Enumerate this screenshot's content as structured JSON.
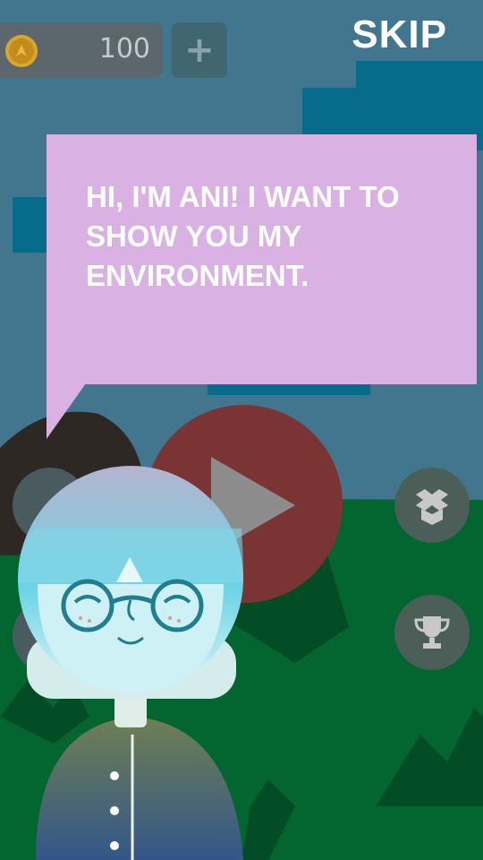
{
  "hud": {
    "coins": "100",
    "add_label": "+",
    "skip_label": "SKIP"
  },
  "dialog": {
    "text": "HI, I'M ANI! I WANT TO SHOW YOU MY ENVIRONMENT."
  },
  "icons": {
    "coin": "coin-icon",
    "add": "plus-icon",
    "play": "play-icon",
    "box": "dropbox-icon",
    "trophy": "trophy-icon"
  },
  "colors": {
    "sky": "#41768e",
    "grass": "#036631",
    "bubble": "#d9b1e3",
    "play_button": "#7a3434"
  }
}
